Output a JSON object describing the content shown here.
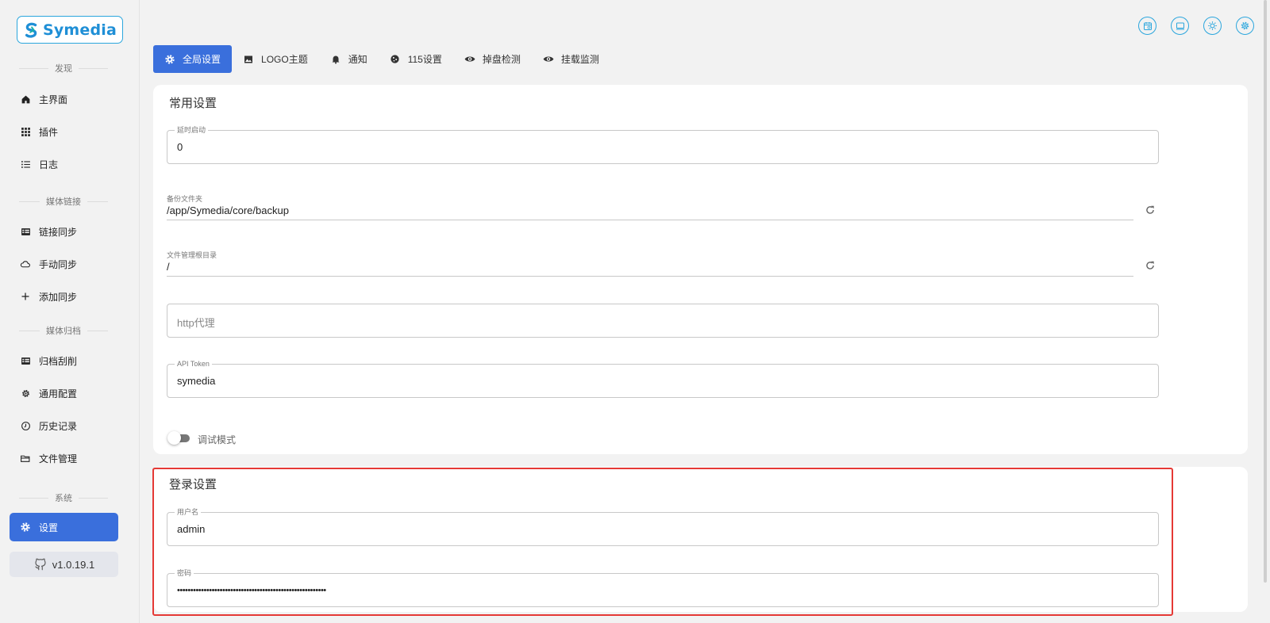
{
  "app": {
    "logo_text": "Symedia",
    "version": "v1.0.19.1"
  },
  "sidebar": {
    "sections": [
      {
        "title": "发现"
      },
      {
        "title": "媒体链接"
      },
      {
        "title": "媒体归档"
      },
      {
        "title": "系统"
      }
    ],
    "items": [
      {
        "label": "主界面",
        "icon": "home-icon"
      },
      {
        "label": "插件",
        "icon": "grid-icon"
      },
      {
        "label": "日志",
        "icon": "list-icon"
      },
      {
        "label": "链接同步",
        "icon": "table-icon"
      },
      {
        "label": "手动同步",
        "icon": "cloud-icon"
      },
      {
        "label": "添加同步",
        "icon": "plus-icon"
      },
      {
        "label": "归档刮削",
        "icon": "table-icon"
      },
      {
        "label": "通用配置",
        "icon": "gear-icon"
      },
      {
        "label": "历史记录",
        "icon": "clock-icon"
      },
      {
        "label": "文件管理",
        "icon": "folder-icon"
      },
      {
        "label": "设置",
        "icon": "gear-icon",
        "active": true
      }
    ]
  },
  "tabs": [
    {
      "label": "全局设置",
      "icon": "gear-icon",
      "active": true
    },
    {
      "label": "LOGO主题",
      "icon": "image-icon"
    },
    {
      "label": "通知",
      "icon": "bell-icon"
    },
    {
      "label": "115设置",
      "icon": "cookie-icon"
    },
    {
      "label": "掉盘检测",
      "icon": "eye-icon"
    },
    {
      "label": "挂载监测",
      "icon": "eye-icon"
    }
  ],
  "general": {
    "title": "常用设置",
    "delay_label": "延时启动",
    "delay_value": "0",
    "backup_label": "备份文件夹",
    "backup_value": "/app/Symedia/core/backup",
    "filemgr_label": "文件管理根目录",
    "filemgr_value": "/",
    "proxy_placeholder": "http代理",
    "token_label": "API Token",
    "token_value": "symedia",
    "debug_label": "调试模式",
    "debug_enabled": false
  },
  "login": {
    "title": "登录设置",
    "username_label": "用户名",
    "username_value": "admin",
    "password_label": "密码",
    "password_value": "••••••••••••••••••••••••••••••••••••••••••••••••••••••••"
  },
  "colors": {
    "accent": "#3a6fdc",
    "brand": "#2ba6dd",
    "highlight": "#e53935"
  }
}
